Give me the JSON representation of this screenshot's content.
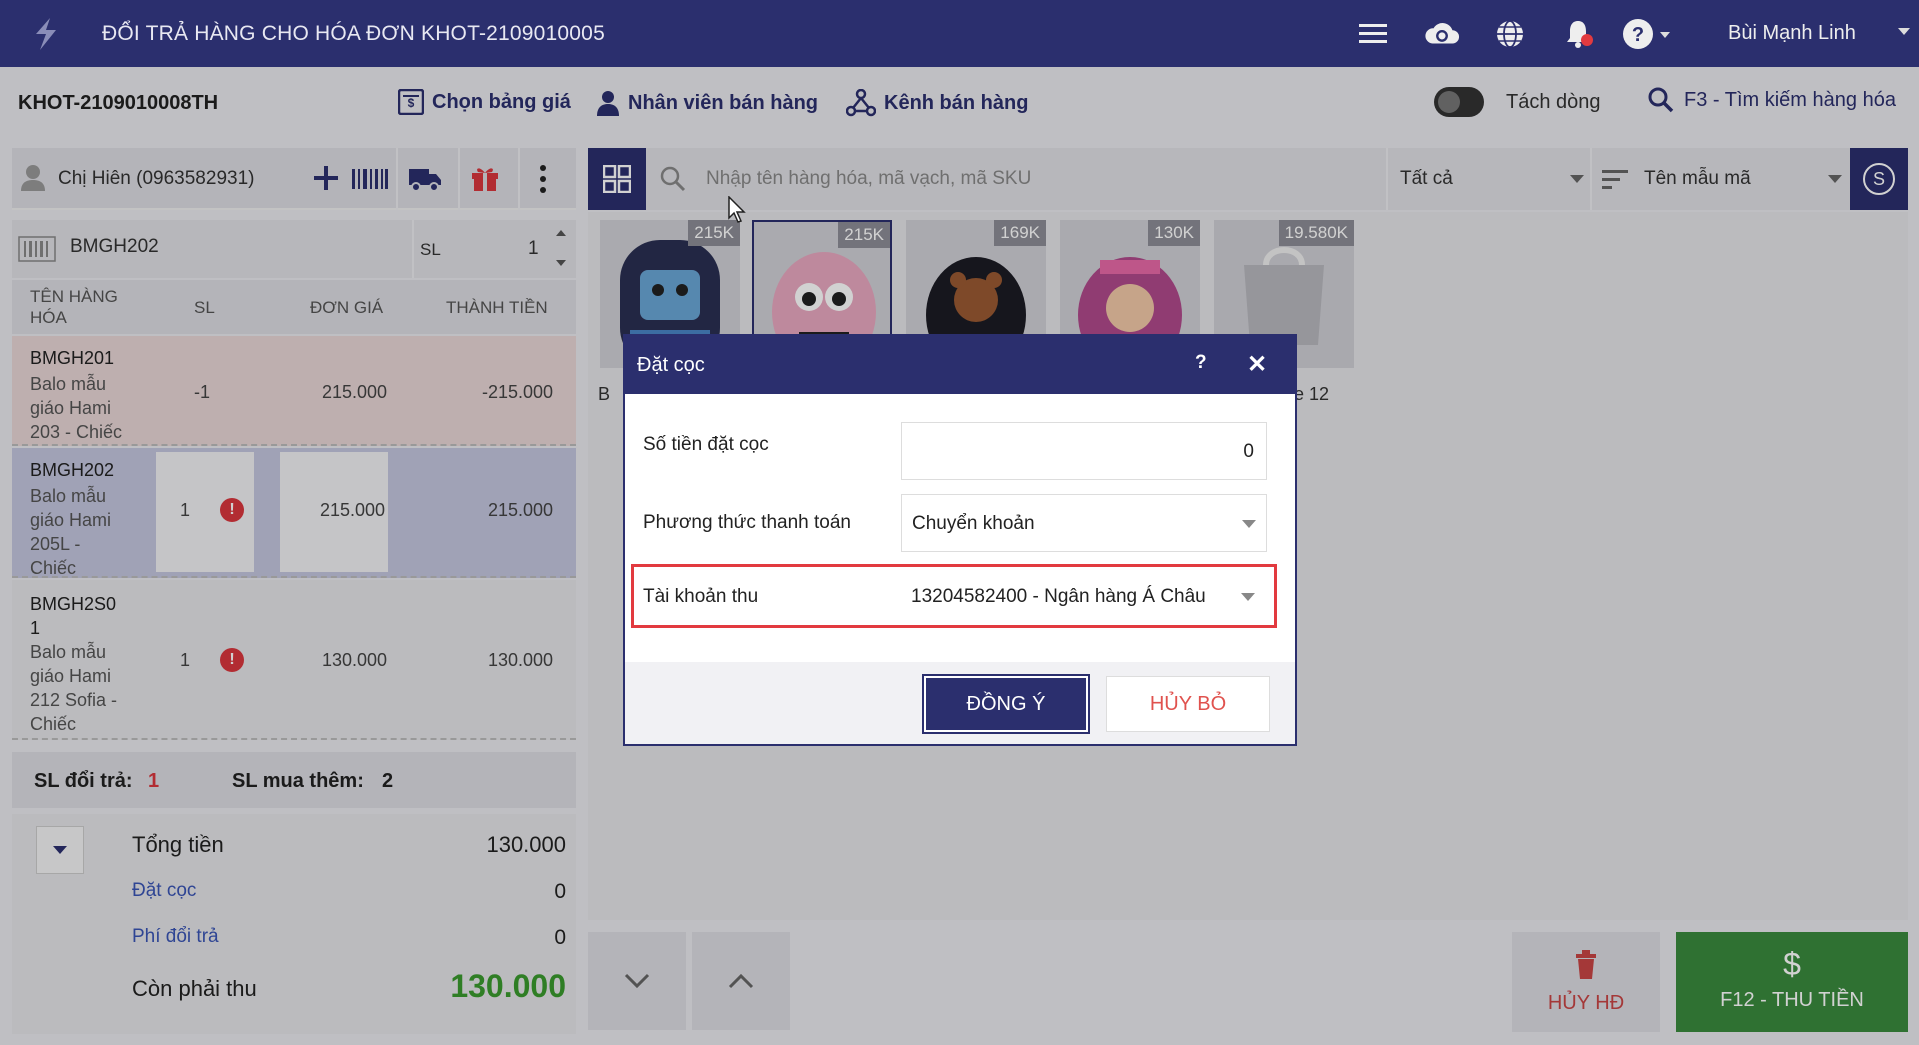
{
  "header": {
    "title": "ĐỔI TRẢ HÀNG CHO HÓA ĐƠN KHOT-2109010005",
    "user_name": "Bùi Mạnh Linh",
    "icons": [
      "menu-icon",
      "cloud-sync-icon",
      "globe-icon",
      "bell-icon",
      "help-icon"
    ]
  },
  "toolbar": {
    "order_code": "KHOT-2109010008TH",
    "price_list": "Chọn bảng giá",
    "staff": "Nhân viên bán hàng",
    "channel": "Kênh bán hàng",
    "split_line": "Tách dòng",
    "search_shortcut": "F3 - Tìm kiếm hàng hóa"
  },
  "customer": {
    "name": "Chị Hiên (0963582931)"
  },
  "sku_entry": {
    "value": "BMGH202",
    "qty_label": "SL",
    "qty": "1"
  },
  "table": {
    "headers": {
      "name": "TÊN HÀNG HÓA",
      "qty": "SL",
      "price": "ĐƠN GIÁ",
      "total": "THÀNH TIỀN"
    },
    "rows": [
      {
        "code": "BMGH201",
        "desc": "Balo mẫu giáo Hami 203 - Chiếc",
        "qty": "-1",
        "price": "215.000",
        "total": "-215.000"
      },
      {
        "code": "BMGH202",
        "desc": "Balo mẫu giáo Hami 205L - Chiếc",
        "qty": "1",
        "price": "215.000",
        "total": "215.000"
      },
      {
        "code": "BMGH2S0 1",
        "desc": "Balo mẫu giáo Hami 212 Sofia - Chiếc",
        "qty": "1",
        "price": "130.000",
        "total": "130.000"
      }
    ]
  },
  "summary": {
    "return_qty_label": "SL đổi trả:",
    "return_qty": "1",
    "buy_more_label": "SL mua thêm:",
    "buy_more": "2",
    "total_label": "Tổng tiền",
    "total": "130.000",
    "deposit_label": "Đặt cọc",
    "deposit": "0",
    "return_fee_label": "Phí đổi trả",
    "return_fee": "0",
    "remaining_label": "Còn phải thu",
    "remaining": "130.000"
  },
  "search": {
    "placeholder": "Nhập tên hàng hóa, mã vạch, mã SKU",
    "category": "Tất cả",
    "sort": "Tên mẫu mã",
    "s_button": "S"
  },
  "products": [
    {
      "price": "215K",
      "name_fragment": "B"
    },
    {
      "price": "215K",
      "name_fragment": ""
    },
    {
      "price": "169K",
      "name_fragment": ""
    },
    {
      "price": "130K",
      "name_fragment": ""
    },
    {
      "price": "19.580K",
      "name_fragment": "e 12"
    }
  ],
  "bottom": {
    "cancel_invoice": "HỦY HĐ",
    "pay": "F12 - THU TIỀN"
  },
  "modal": {
    "title": "Đặt cọc",
    "help": "?",
    "close": "✕",
    "deposit_amount_label": "Số tiền đặt cọc",
    "deposit_amount": "0",
    "payment_method_label": "Phương thức thanh toán",
    "payment_method": "Chuyển khoản",
    "account_label": "Tài khoản thu",
    "account": "13204582400 - Ngân hàng Á Châu",
    "ok": "ĐỒNG Ý",
    "cancel": "HỦY BỎ"
  },
  "colors": {
    "brand": "#2b2f6e",
    "pay_green": "#3a8a3e",
    "danger": "#d9363e",
    "remaining_green": "#3a9a2e"
  }
}
